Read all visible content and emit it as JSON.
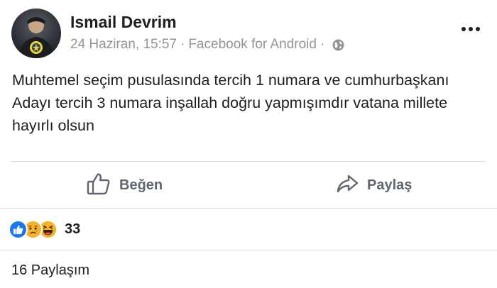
{
  "post": {
    "author": "Ismail Devrim",
    "date": "24 Haziran, 15:57",
    "separator": "·",
    "source": "Facebook for Android",
    "text": "Muhtemel seçim pusulasında tercih 1 numara ve cumhurbaşkanı Adayı tercih 3 numara inşallah doğru yapmışımdır vatana millete hayırlı olsun"
  },
  "actions": {
    "like_label": "Beğen",
    "share_label": "Paylaş"
  },
  "reactions": {
    "icons": [
      "like-reaction-icon",
      "sad-reaction-icon",
      "haha-reaction-icon"
    ],
    "count": "33"
  },
  "shares": {
    "label": "16 Paylaşım"
  },
  "colors": {
    "text": "#1c1e21",
    "meta": "#90949c",
    "action": "#606770",
    "like_blue": "#1877f2",
    "emoji_yellow": "#f7b125"
  }
}
